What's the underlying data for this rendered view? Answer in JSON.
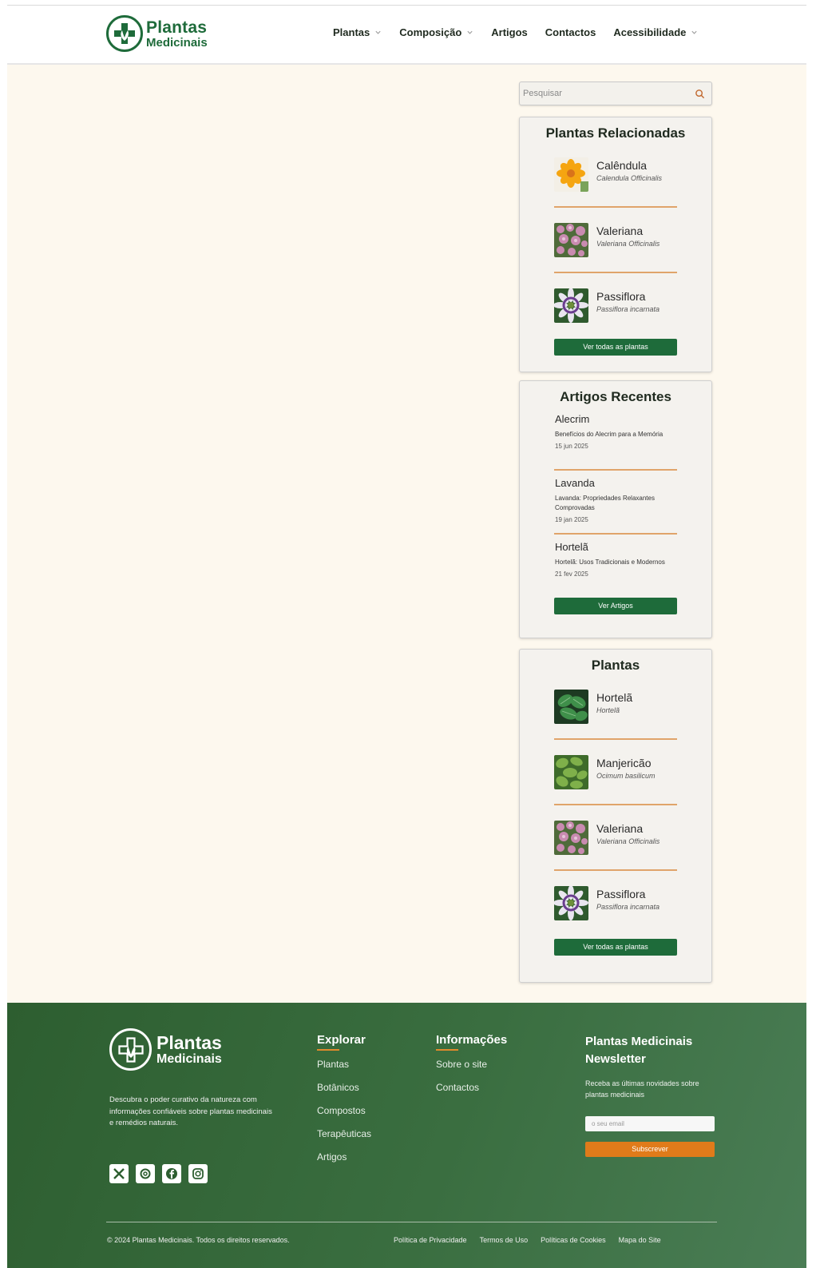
{
  "header": {
    "logo_line1": "Plantas",
    "logo_line2": "Medicinais",
    "nav": [
      {
        "label": "Plantas",
        "has_dropdown": true
      },
      {
        "label": "Composição",
        "has_dropdown": true
      },
      {
        "label": "Artigos",
        "has_dropdown": false
      },
      {
        "label": "Contactos",
        "has_dropdown": false
      },
      {
        "label": "Acessibilidade",
        "has_dropdown": true
      }
    ]
  },
  "search": {
    "placeholder": "Pesquisar"
  },
  "related": {
    "title": "Plantas Relacionadas",
    "items": [
      {
        "name": "Calêndula",
        "scientific": "Calendula Officinalis",
        "image": "calendula-flower"
      },
      {
        "name": "Valeriana",
        "scientific": "Valeriana Officinalis",
        "image": "valeriana-flower"
      },
      {
        "name": "Passiflora",
        "scientific": "Passiflora incarnata",
        "image": "passiflora-flower"
      }
    ],
    "button": "Ver todas as plantas"
  },
  "articles": {
    "title": "Artigos Recentes",
    "items": [
      {
        "title": "Alecrim",
        "description": "Benefícios do Alecrim para a Memória",
        "date": "15 jun 2025"
      },
      {
        "title": "Lavanda",
        "description": "Lavanda: Propriedades Relaxantes Comprovadas",
        "date": "19 jan 2025"
      },
      {
        "title": "Hortelã",
        "description": "Hortelã: Usos Tradicionais e Modernos",
        "date": "21 fev 2025"
      }
    ],
    "button": "Ver Artigos"
  },
  "plants": {
    "title": "Plantas",
    "items": [
      {
        "name": "Hortelã",
        "scientific": "Hortelã",
        "image": "mint-leaves"
      },
      {
        "name": "Manjericão",
        "scientific": "Ocimum basilicum",
        "image": "basil-leaves"
      },
      {
        "name": "Valeriana",
        "scientific": "Valeriana Officinalis",
        "image": "valeriana-flower"
      },
      {
        "name": "Passiflora",
        "scientific": "Passiflora incarnata",
        "image": "passiflora-flower"
      }
    ],
    "button": "Ver todas as plantas"
  },
  "footer": {
    "logo_line1": "Plantas",
    "logo_line2": "Medicinais",
    "description": "Descubra o poder curativo da natureza com informações confiáveis sobre plantas medicinais e remédios naturais.",
    "social": [
      "x-icon",
      "threads-icon",
      "facebook-icon",
      "instagram-icon"
    ],
    "explore": {
      "title": "Explorar",
      "links": [
        "Plantas",
        "Botânicos",
        "Compostos",
        "Terapêuticas",
        "Artigos"
      ]
    },
    "info": {
      "title": "Informações",
      "links": [
        "Sobre o site",
        "Contactos"
      ]
    },
    "newsletter": {
      "title": "Plantas Medicinais Newsletter",
      "text": "Receba as últimas novidades sobre plantas medicinais",
      "placeholder": "o seu email",
      "button": "Subscrever"
    },
    "copyright": "© 2024 Plantas Medicinais. Todos os direitos reservados.",
    "legal": [
      "Política de Privacidade",
      "Termos de Uso",
      "Políticas de Cookies",
      "Mapa do Site"
    ]
  },
  "colors": {
    "brand_green": "#1e6b3a",
    "accent_orange": "#e07b1a",
    "page_bg": "#fdf8ee",
    "footer_green": "#3a6e40"
  }
}
